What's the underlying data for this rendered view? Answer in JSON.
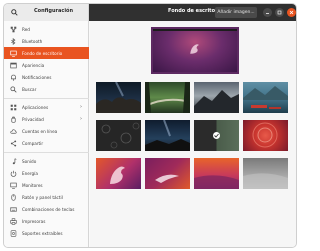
{
  "header": {
    "title": "Configuración",
    "page_title": "Fondo de escritorio",
    "add_image_label": "Añadir imagen..."
  },
  "sidebar": {
    "items": [
      {
        "label": "Red",
        "icon": "network-icon"
      },
      {
        "label": "Bluetooth",
        "icon": "bluetooth-icon"
      },
      {
        "label": "Fondo de escritorio",
        "icon": "desktop-icon"
      },
      {
        "label": "Apariencia",
        "icon": "appearance-icon"
      },
      {
        "label": "Notificaciones",
        "icon": "bell-icon"
      },
      {
        "label": "Buscar",
        "icon": "search-icon"
      },
      {
        "label": "Aplicaciones",
        "icon": "apps-icon"
      },
      {
        "label": "Privacidad",
        "icon": "hand-icon"
      },
      {
        "label": "Cuentas en línea",
        "icon": "cloud-icon"
      },
      {
        "label": "Compartir",
        "icon": "share-icon"
      },
      {
        "label": "Sonido",
        "icon": "music-icon"
      },
      {
        "label": "Energía",
        "icon": "power-icon"
      },
      {
        "label": "Monitores",
        "icon": "monitor-icon"
      },
      {
        "label": "Ratón y panel táctil",
        "icon": "mouse-icon"
      },
      {
        "label": "Combinaciones de teclas",
        "icon": "keyboard-icon"
      },
      {
        "label": "Impresoras",
        "icon": "printer-icon"
      },
      {
        "label": "Soportes extraíbles",
        "icon": "media-icon"
      }
    ]
  },
  "wallpapers": [
    {
      "name": "wallpaper-milky-way-rocks",
      "selected": false
    },
    {
      "name": "wallpaper-forest-bridge",
      "selected": false
    },
    {
      "name": "wallpaper-mountain-ridge",
      "selected": false
    },
    {
      "name": "wallpaper-red-boat-lake",
      "selected": false
    },
    {
      "name": "wallpaper-dark-floral",
      "selected": false
    },
    {
      "name": "wallpaper-night-sky",
      "selected": false
    },
    {
      "name": "wallpaper-split-green-dark",
      "selected": false
    },
    {
      "name": "wallpaper-pink-circles",
      "selected": false
    },
    {
      "name": "wallpaper-purple-mascot",
      "selected": false
    },
    {
      "name": "wallpaper-purple-swoosh",
      "selected": true
    },
    {
      "name": "wallpaper-orange-gradient",
      "selected": false
    },
    {
      "name": "wallpaper-grey-gradient",
      "selected": false
    }
  ],
  "colors": {
    "accent": "#e95420",
    "header_dark": "#303030",
    "preview_purple": "#6b2d6c"
  }
}
